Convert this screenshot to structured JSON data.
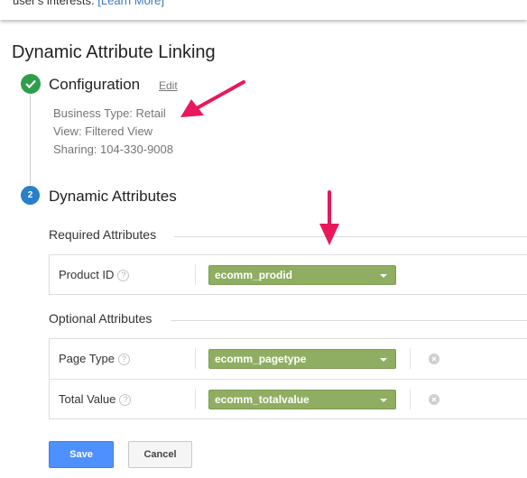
{
  "top_strip": {
    "text": "user's interests.",
    "link": "[Learn More]"
  },
  "page_title": "Dynamic Attribute Linking",
  "steps": [
    {
      "title": "Configuration",
      "edit_label": "Edit",
      "details": [
        "Business Type: Retail",
        "View: Filtered View",
        "Sharing: 104-330-9008"
      ]
    },
    {
      "number": "2",
      "title": "Dynamic Attributes"
    }
  ],
  "required": {
    "heading": "Required Attributes",
    "rows": [
      {
        "label": "Product ID",
        "value": "ecomm_prodid"
      }
    ]
  },
  "optional": {
    "heading": "Optional Attributes",
    "rows": [
      {
        "label": "Page Type",
        "value": "ecomm_pagetype"
      },
      {
        "label": "Total Value",
        "value": "ecomm_totalvalue"
      }
    ]
  },
  "help_glyph": "?",
  "buttons": {
    "save": "Save",
    "cancel": "Cancel"
  },
  "colors": {
    "accent_green": "#8fae62",
    "check_green": "#2e9e4b",
    "step_blue": "#2a7fc9",
    "save_blue": "#4d90fe",
    "annotation_arrow": "#e8185a"
  }
}
